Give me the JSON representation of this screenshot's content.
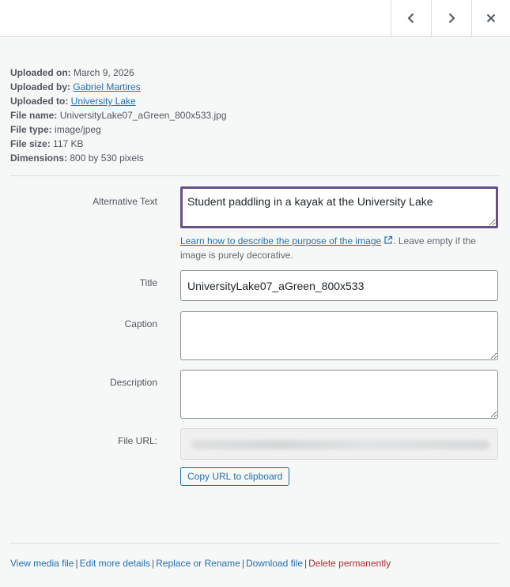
{
  "nav": {
    "prev_icon": "chevron-left-icon",
    "next_icon": "chevron-right-icon",
    "close_icon": "close-icon"
  },
  "meta": {
    "uploaded_on_label": "Uploaded on:",
    "uploaded_on": "March 9, 2026",
    "uploaded_by_label": "Uploaded by:",
    "uploaded_by": "Gabriel Martires",
    "uploaded_to_label": "Uploaded to:",
    "uploaded_to": "University Lake",
    "file_name_label": "File name:",
    "file_name": "UniversityLake07_aGreen_800x533.jpg",
    "file_type_label": "File type:",
    "file_type": "image/jpeg",
    "file_size_label": "File size:",
    "file_size": "117 KB",
    "dimensions_label": "Dimensions:",
    "dimensions": "800 by 530 pixels"
  },
  "form": {
    "alt_label": "Alternative Text",
    "alt_value": "Student paddling in a kayak at the University Lake",
    "help_link": "Learn how to describe the purpose of the image",
    "help_text": ". Leave empty if the image is purely decorative.",
    "title_label": "Title",
    "title_value": "UniversityLake07_aGreen_800x533",
    "caption_label": "Caption",
    "caption_value": "",
    "description_label": "Description",
    "description_value": "",
    "url_label": "File URL:",
    "copy_button": "Copy URL to clipboard"
  },
  "actions": {
    "view": "View media file",
    "edit": "Edit more details",
    "replace": "Replace or Rename",
    "download": "Download file",
    "delete": "Delete permanently",
    "separator": "|"
  },
  "colors": {
    "link": "#2271b1",
    "danger": "#b32d2e",
    "focus_border": "#674e8c"
  }
}
